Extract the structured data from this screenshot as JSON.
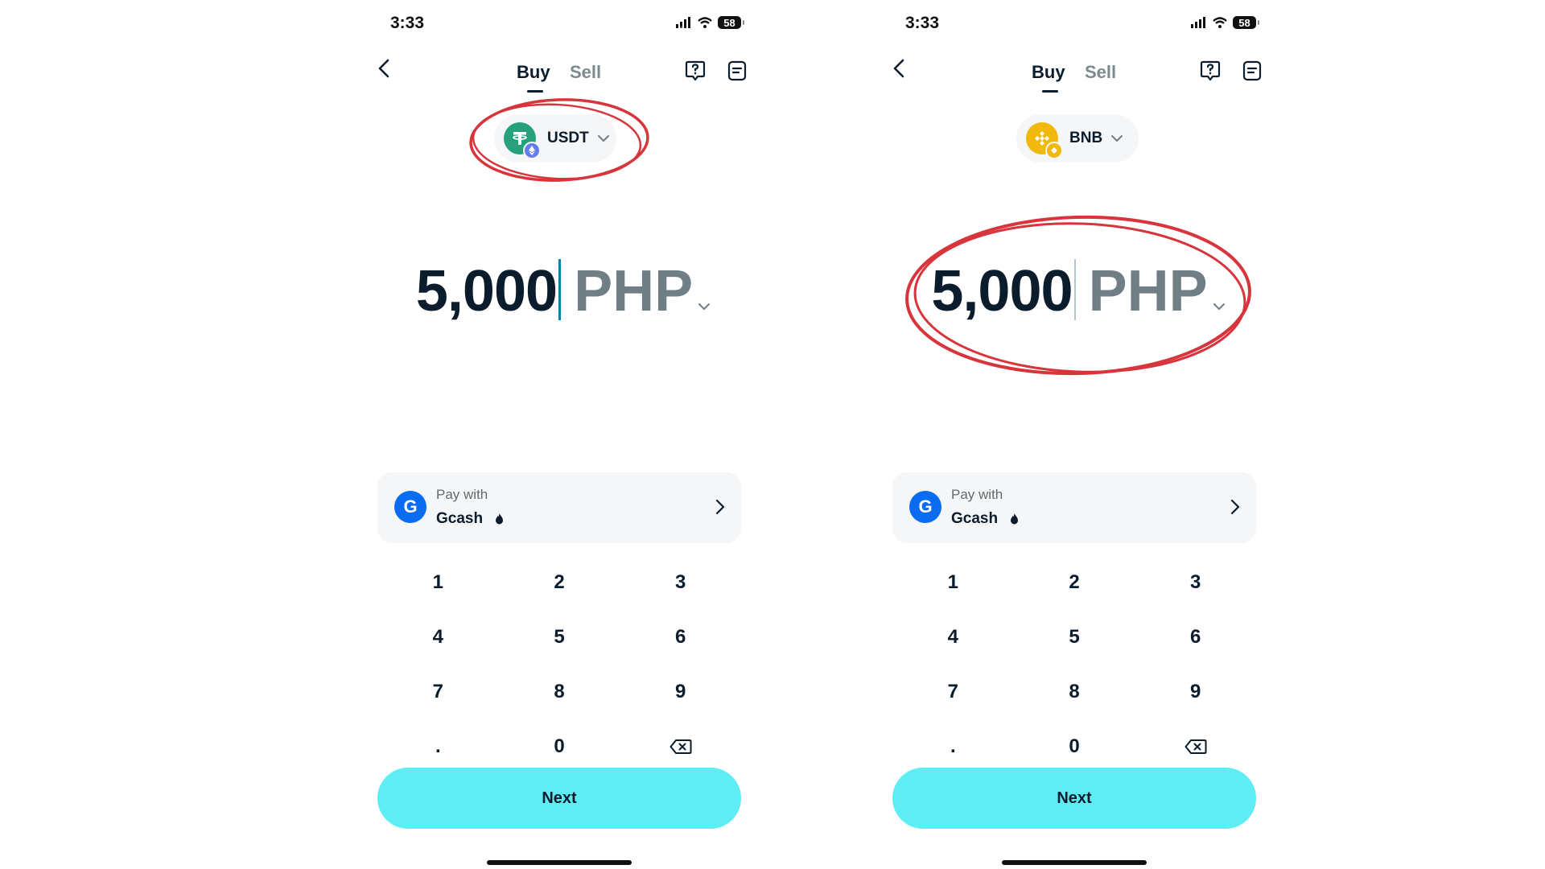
{
  "screens": [
    {
      "status": {
        "time": "3:33",
        "battery": "58"
      },
      "tabs": [
        {
          "label": "Buy",
          "active": true
        },
        {
          "label": "Sell",
          "active": false
        }
      ],
      "asset": {
        "name": "USDT",
        "icon": "tether-icon",
        "network_badge": "ethereum-icon"
      },
      "amount": {
        "value": "5,000",
        "currency": "PHP"
      },
      "payment": {
        "label": "Pay with",
        "method": "Gcash",
        "icon": "gcash-icon"
      },
      "keypad": [
        "1",
        "2",
        "3",
        "4",
        "5",
        "6",
        "7",
        "8",
        "9",
        ".",
        "0"
      ],
      "next_label": "Next",
      "highlight": "asset-selector"
    },
    {
      "status": {
        "time": "3:33",
        "battery": "58"
      },
      "tabs": [
        {
          "label": "Buy",
          "active": true
        },
        {
          "label": "Sell",
          "active": false
        }
      ],
      "asset": {
        "name": "BNB",
        "icon": "bnb-icon",
        "network_badge": "bnb-chain-icon"
      },
      "amount": {
        "value": "5,000",
        "currency": "PHP"
      },
      "payment": {
        "label": "Pay with",
        "method": "Gcash",
        "icon": "gcash-icon"
      },
      "keypad": [
        "1",
        "2",
        "3",
        "4",
        "5",
        "6",
        "7",
        "8",
        "9",
        ".",
        "0"
      ],
      "next_label": "Next",
      "highlight": "amount-display"
    }
  ],
  "colors": {
    "accent_button": "#5eedf5",
    "text_primary": "#0b1c2c",
    "text_muted": "#6f7f85",
    "card_bg": "#f4f6f7",
    "annotation_red": "#d8343c",
    "usdt_green": "#26a17b",
    "bnb_yellow": "#f0b90b",
    "gcash_blue": "#0a6cf1"
  }
}
